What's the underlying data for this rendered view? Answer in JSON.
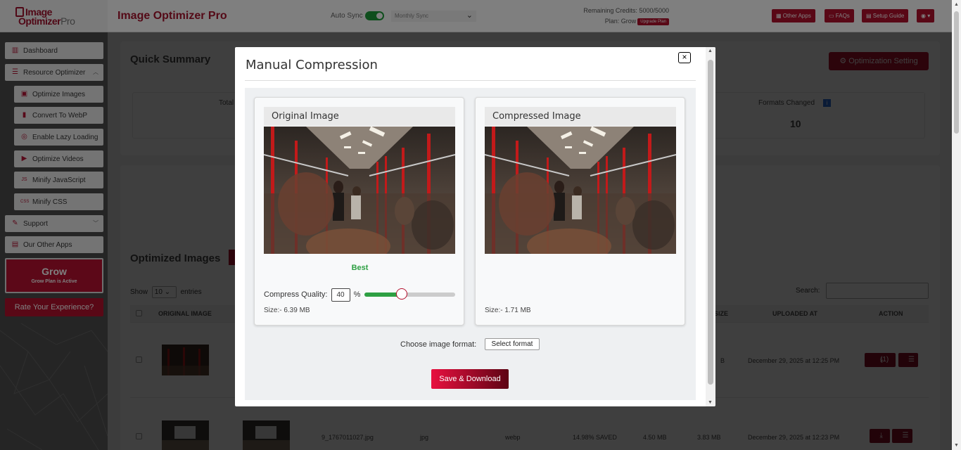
{
  "app": {
    "logo_line1": "Image",
    "logo_line2": "Optimizer",
    "logo_line2_suffix": "Pro",
    "title": "Image Optimizer Pro"
  },
  "header": {
    "auto_sync_label": "Auto Sync",
    "auto_sync_on": true,
    "sync_frequency": "Monthly Sync",
    "credits_label": "Remaining Credits:",
    "credits_value": "5000/5000",
    "plan_label": "Plan: Grow",
    "upgrade_label": "Upgrade Plan",
    "buttons": {
      "other_apps": "Other Apps",
      "faqs": "FAQs",
      "setup_guide": "Setup Guide"
    }
  },
  "sidebar": {
    "dashboard": "Dashboard",
    "resource_optimizer": "Resource Optimizer",
    "sub_items": [
      "Optimize Images",
      "Convert To WebP",
      "Enable Lazy Loading",
      "Optimize Videos",
      "Minify JavaScript",
      "Minify CSS"
    ],
    "support": "Support",
    "our_other_apps": "Our Other Apps",
    "plan_name": "Grow",
    "plan_status": "Grow Plan is Active",
    "rate_label": "Rate Your Experience?"
  },
  "summary": {
    "title": "Quick Summary",
    "optimization_setting": "Optimization Setting",
    "total_label_partial": "Total",
    "formats_changed_label": "Formats Changed",
    "formats_changed_value": "10"
  },
  "images_table": {
    "title": "Optimized Images",
    "show_label": "Show",
    "entries_value": "10",
    "entries_label": "entries",
    "search_label": "Search:",
    "headers": {
      "original": "ORIGINAL IMAGE",
      "size": "SIZE",
      "uploaded_at": "UPLOADED AT",
      "action": "ACTION"
    },
    "rows": [
      {
        "size_partial": "B",
        "uploaded_at": "December 29, 2025 at 12:25 PM",
        "download_count": "(1)"
      },
      {
        "file_name": "9_1767011027.jpg",
        "orig_format": "jpg",
        "new_format": "webp",
        "saved": "14.98% SAVED",
        "orig_size": "4.50 MB",
        "new_size": "3.83 MB",
        "uploaded_at": "December 29, 2025 at 12:23 PM"
      }
    ]
  },
  "modal": {
    "title": "Manual Compression",
    "close_glyph": "×",
    "original_title": "Original Image",
    "compressed_title": "Compressed Image",
    "quality_word": "Best",
    "compress_quality_label": "Compress Quality:",
    "quality_value": "40",
    "percent_sign": "%",
    "quality_fraction": 0.4,
    "original_size": "Size:- 6.39 MB",
    "compressed_size": "Size:- 1.71 MB",
    "choose_format_label": "Choose image format:",
    "select_format_label": "Select format",
    "save_label": "Save & Download"
  },
  "colors": {
    "brand": "#b3102d",
    "success": "#2ea043"
  }
}
